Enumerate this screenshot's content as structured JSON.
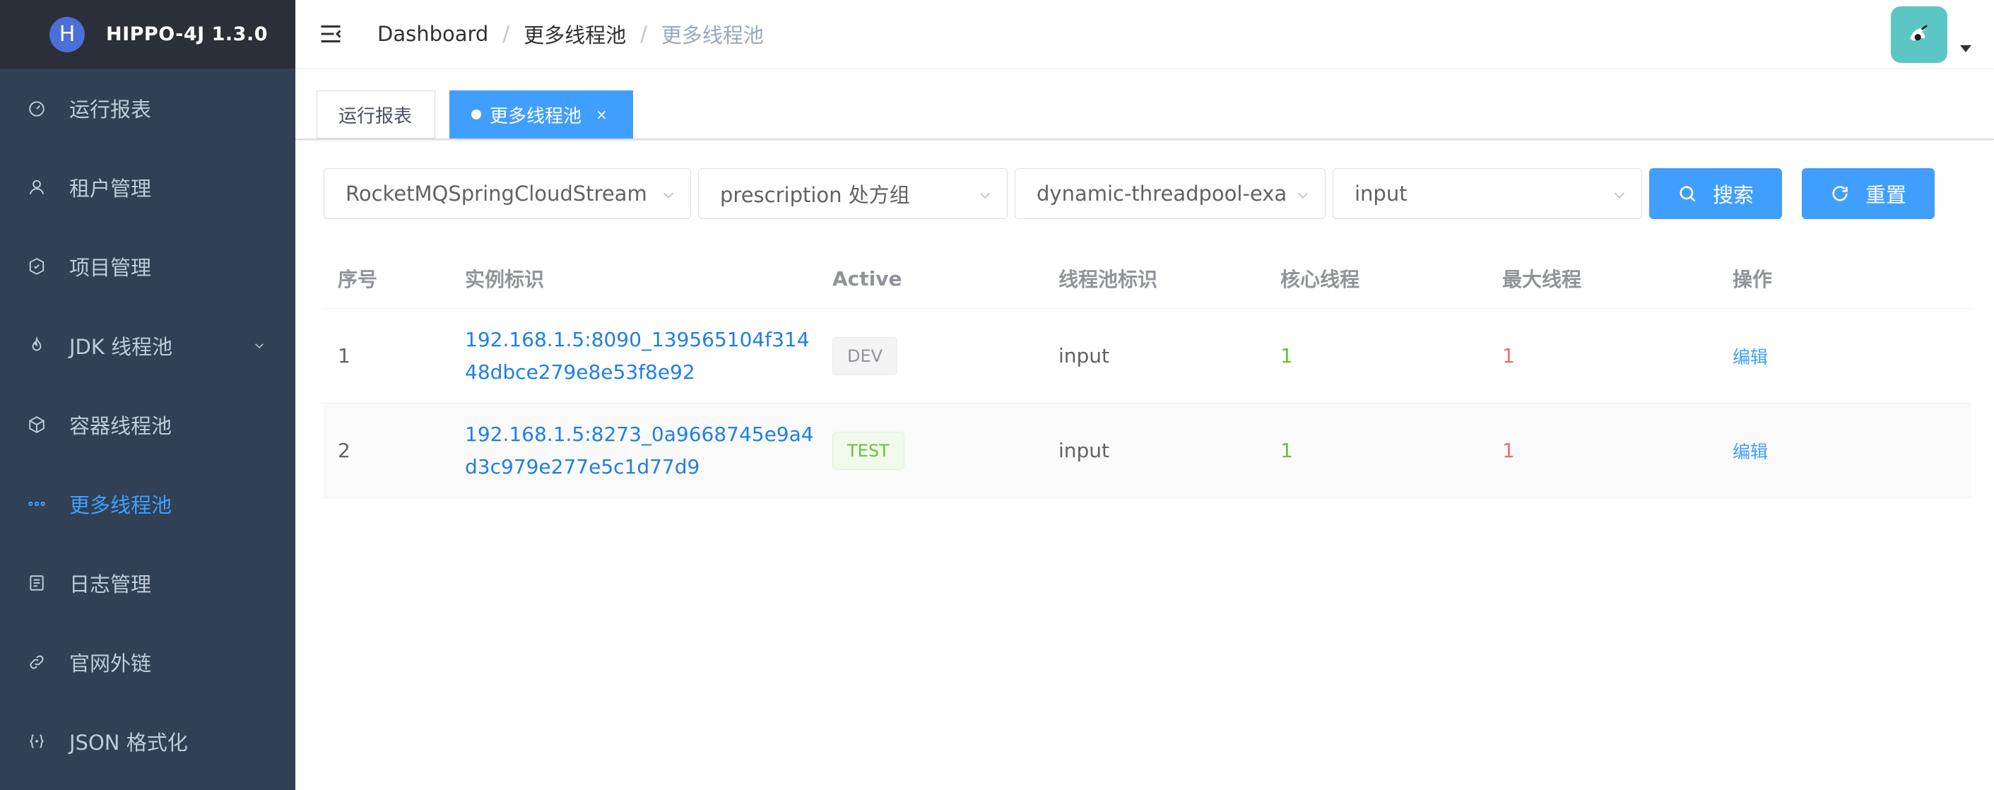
{
  "brand": {
    "logo_letter": "H",
    "title": "HIPPO-4J 1.3.0",
    "logo_color": "#4a6fd8"
  },
  "sidebar": {
    "items": [
      {
        "label": "运行报表",
        "icon": "dashboard-icon",
        "active": false
      },
      {
        "label": "租户管理",
        "icon": "user-icon",
        "active": false
      },
      {
        "label": "项目管理",
        "icon": "project-icon",
        "active": false
      },
      {
        "label": "JDK 线程池",
        "icon": "fire-icon",
        "active": false,
        "expandable": true
      },
      {
        "label": "容器线程池",
        "icon": "box-icon",
        "active": false
      },
      {
        "label": "更多线程池",
        "icon": "more-icon",
        "active": true
      },
      {
        "label": "日志管理",
        "icon": "log-icon",
        "active": false
      },
      {
        "label": "官网外链",
        "icon": "link-icon",
        "active": false
      },
      {
        "label": "JSON 格式化",
        "icon": "json-icon",
        "active": false
      }
    ]
  },
  "breadcrumb": {
    "items": [
      "Dashboard",
      "更多线程池",
      "更多线程池"
    ],
    "separator": "/"
  },
  "tags": [
    {
      "label": "运行报表",
      "active": false
    },
    {
      "label": "更多线程池",
      "active": true,
      "close": "×"
    }
  ],
  "filters": {
    "tenant": "RocketMQSpringCloudStream",
    "group": "prescription 处方组",
    "item": "dynamic-threadpool-example",
    "threadpool": "input",
    "search_label": "搜索",
    "reset_label": "重置"
  },
  "table": {
    "headers": [
      "序号",
      "实例标识",
      "Active",
      "线程池标识",
      "核心线程",
      "最大线程",
      "操作"
    ],
    "rows": [
      {
        "index": "1",
        "instance": "192.168.1.5:8090_139565104f31448dbce279e8e53f8e92",
        "active": "DEV",
        "pool": "input",
        "core": "1",
        "max": "1",
        "action": "编辑"
      },
      {
        "index": "2",
        "instance": "192.168.1.5:8273_0a9668745e9a4d3c979e277e5c1d77d9",
        "active": "TEST",
        "pool": "input",
        "core": "1",
        "max": "1",
        "action": "编辑"
      }
    ]
  },
  "colors": {
    "sidebar_bg": "#304156",
    "accent": "#409eff",
    "core_color": "#67c23a",
    "max_color": "#f56c6c"
  }
}
